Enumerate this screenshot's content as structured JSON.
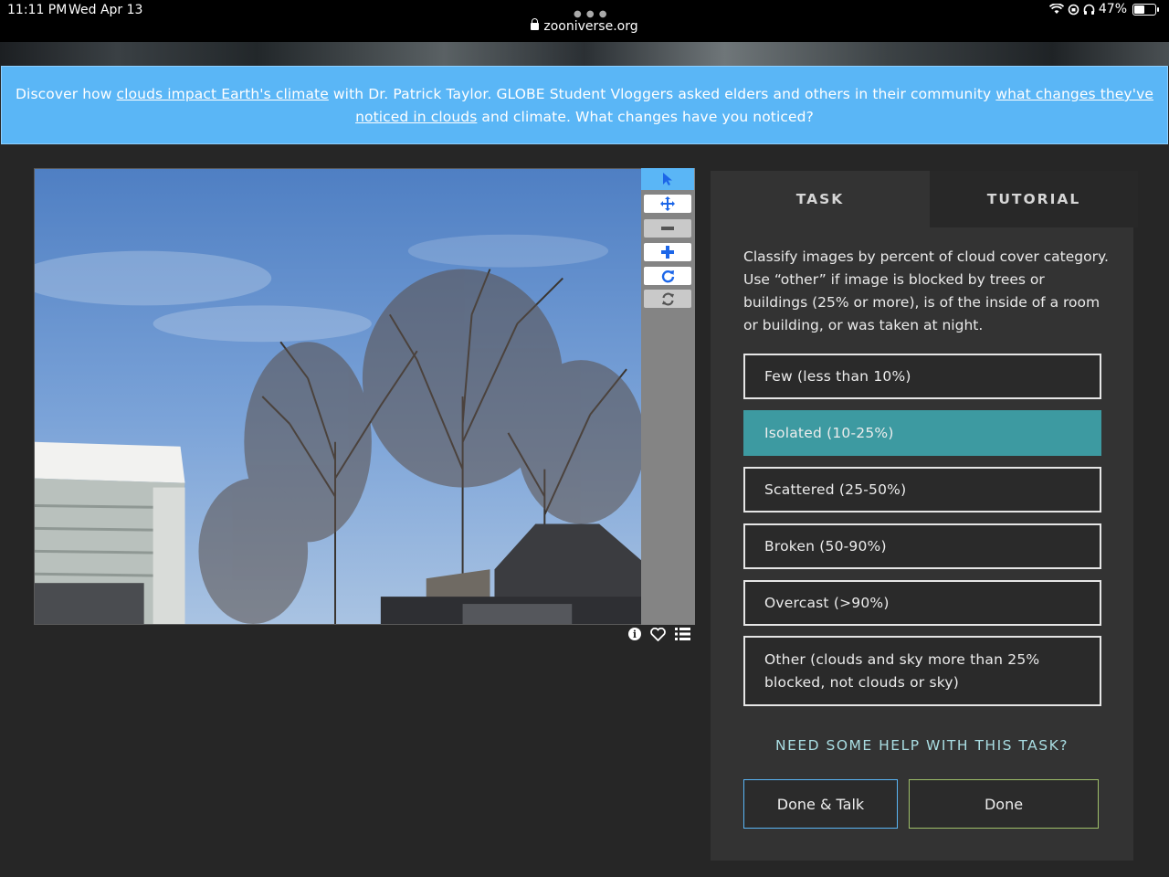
{
  "status_bar": {
    "time": "11:11 PM",
    "date": "Wed Apr 13",
    "url": "zooniverse.org",
    "battery_pct": "47%",
    "battery_level": 0.47
  },
  "banner": {
    "text_1": "Discover how ",
    "link_1": "clouds impact Earth's climate",
    "text_2": " with Dr. Patrick Taylor. GLOBE Student Vloggers asked elders and others in their community ",
    "link_2": "what changes they've noticed in clouds",
    "text_3": " and climate. What changes have you noticed?"
  },
  "toolbar": {
    "tools": [
      "pointer-icon",
      "move-icon",
      "zoom-out-icon",
      "zoom-in-icon",
      "rotate-icon",
      "reset-icon"
    ]
  },
  "meta_icons": [
    "info-icon",
    "heart-icon",
    "collections-icon"
  ],
  "panel": {
    "tabs": [
      {
        "label": "TASK",
        "active": true
      },
      {
        "label": "TUTORIAL",
        "active": false
      }
    ],
    "instructions": "Classify images by percent of cloud cover category. Use “other” if image is blocked by trees or buildings (25% or more), is of the inside of a room or building, or was taken at night.",
    "answers": [
      {
        "label": "Few (less than 10%)",
        "selected": false
      },
      {
        "label": "Isolated (10-25%)",
        "selected": true
      },
      {
        "label": "Scattered (25-50%)",
        "selected": false
      },
      {
        "label": "Broken (50-90%)",
        "selected": false
      },
      {
        "label": "Overcast (>90%)",
        "selected": false
      },
      {
        "label": "Other (clouds and sky more than 25% blocked, not clouds or sky)",
        "selected": false
      }
    ],
    "help_link": "NEED SOME HELP WITH THIS TASK?",
    "done_talk_label": "Done & Talk",
    "done_label": "Done"
  },
  "colors": {
    "banner": "#5ab6f6",
    "selected_answer": "#3d9aa1",
    "help_link": "#a9dde2"
  }
}
